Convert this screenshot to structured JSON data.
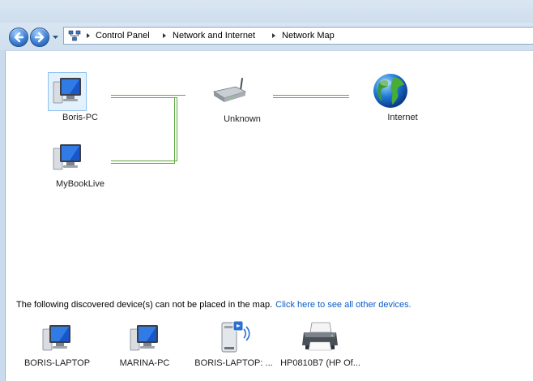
{
  "breadcrumb": [
    "Control Panel",
    "Network and Internet",
    "Network Map"
  ],
  "map": {
    "nodes": [
      {
        "label": "Boris-PC",
        "icon": "computer-icon"
      },
      {
        "label": "MyBookLive",
        "icon": "computer-icon"
      },
      {
        "label": "Unknown",
        "icon": "router-icon"
      },
      {
        "label": "Internet",
        "icon": "globe-icon"
      }
    ]
  },
  "discovered": {
    "message": "The following discovered device(s) can not be placed in the map.",
    "link_text": "Click here to see all other devices.",
    "devices": [
      {
        "label": "BORIS-LAPTOP",
        "icon": "computer-icon"
      },
      {
        "label": "MARINA-PC",
        "icon": "computer-icon"
      },
      {
        "label": "BORIS-LAPTOP: ...",
        "icon": "media-device-icon"
      },
      {
        "label": "HP0810B7 (HP Of...",
        "icon": "printer-icon"
      }
    ]
  },
  "colors": {
    "link_line": "#5faa3f",
    "hyperlink": "#0b5cc9",
    "selection": "#e3f1fd"
  }
}
